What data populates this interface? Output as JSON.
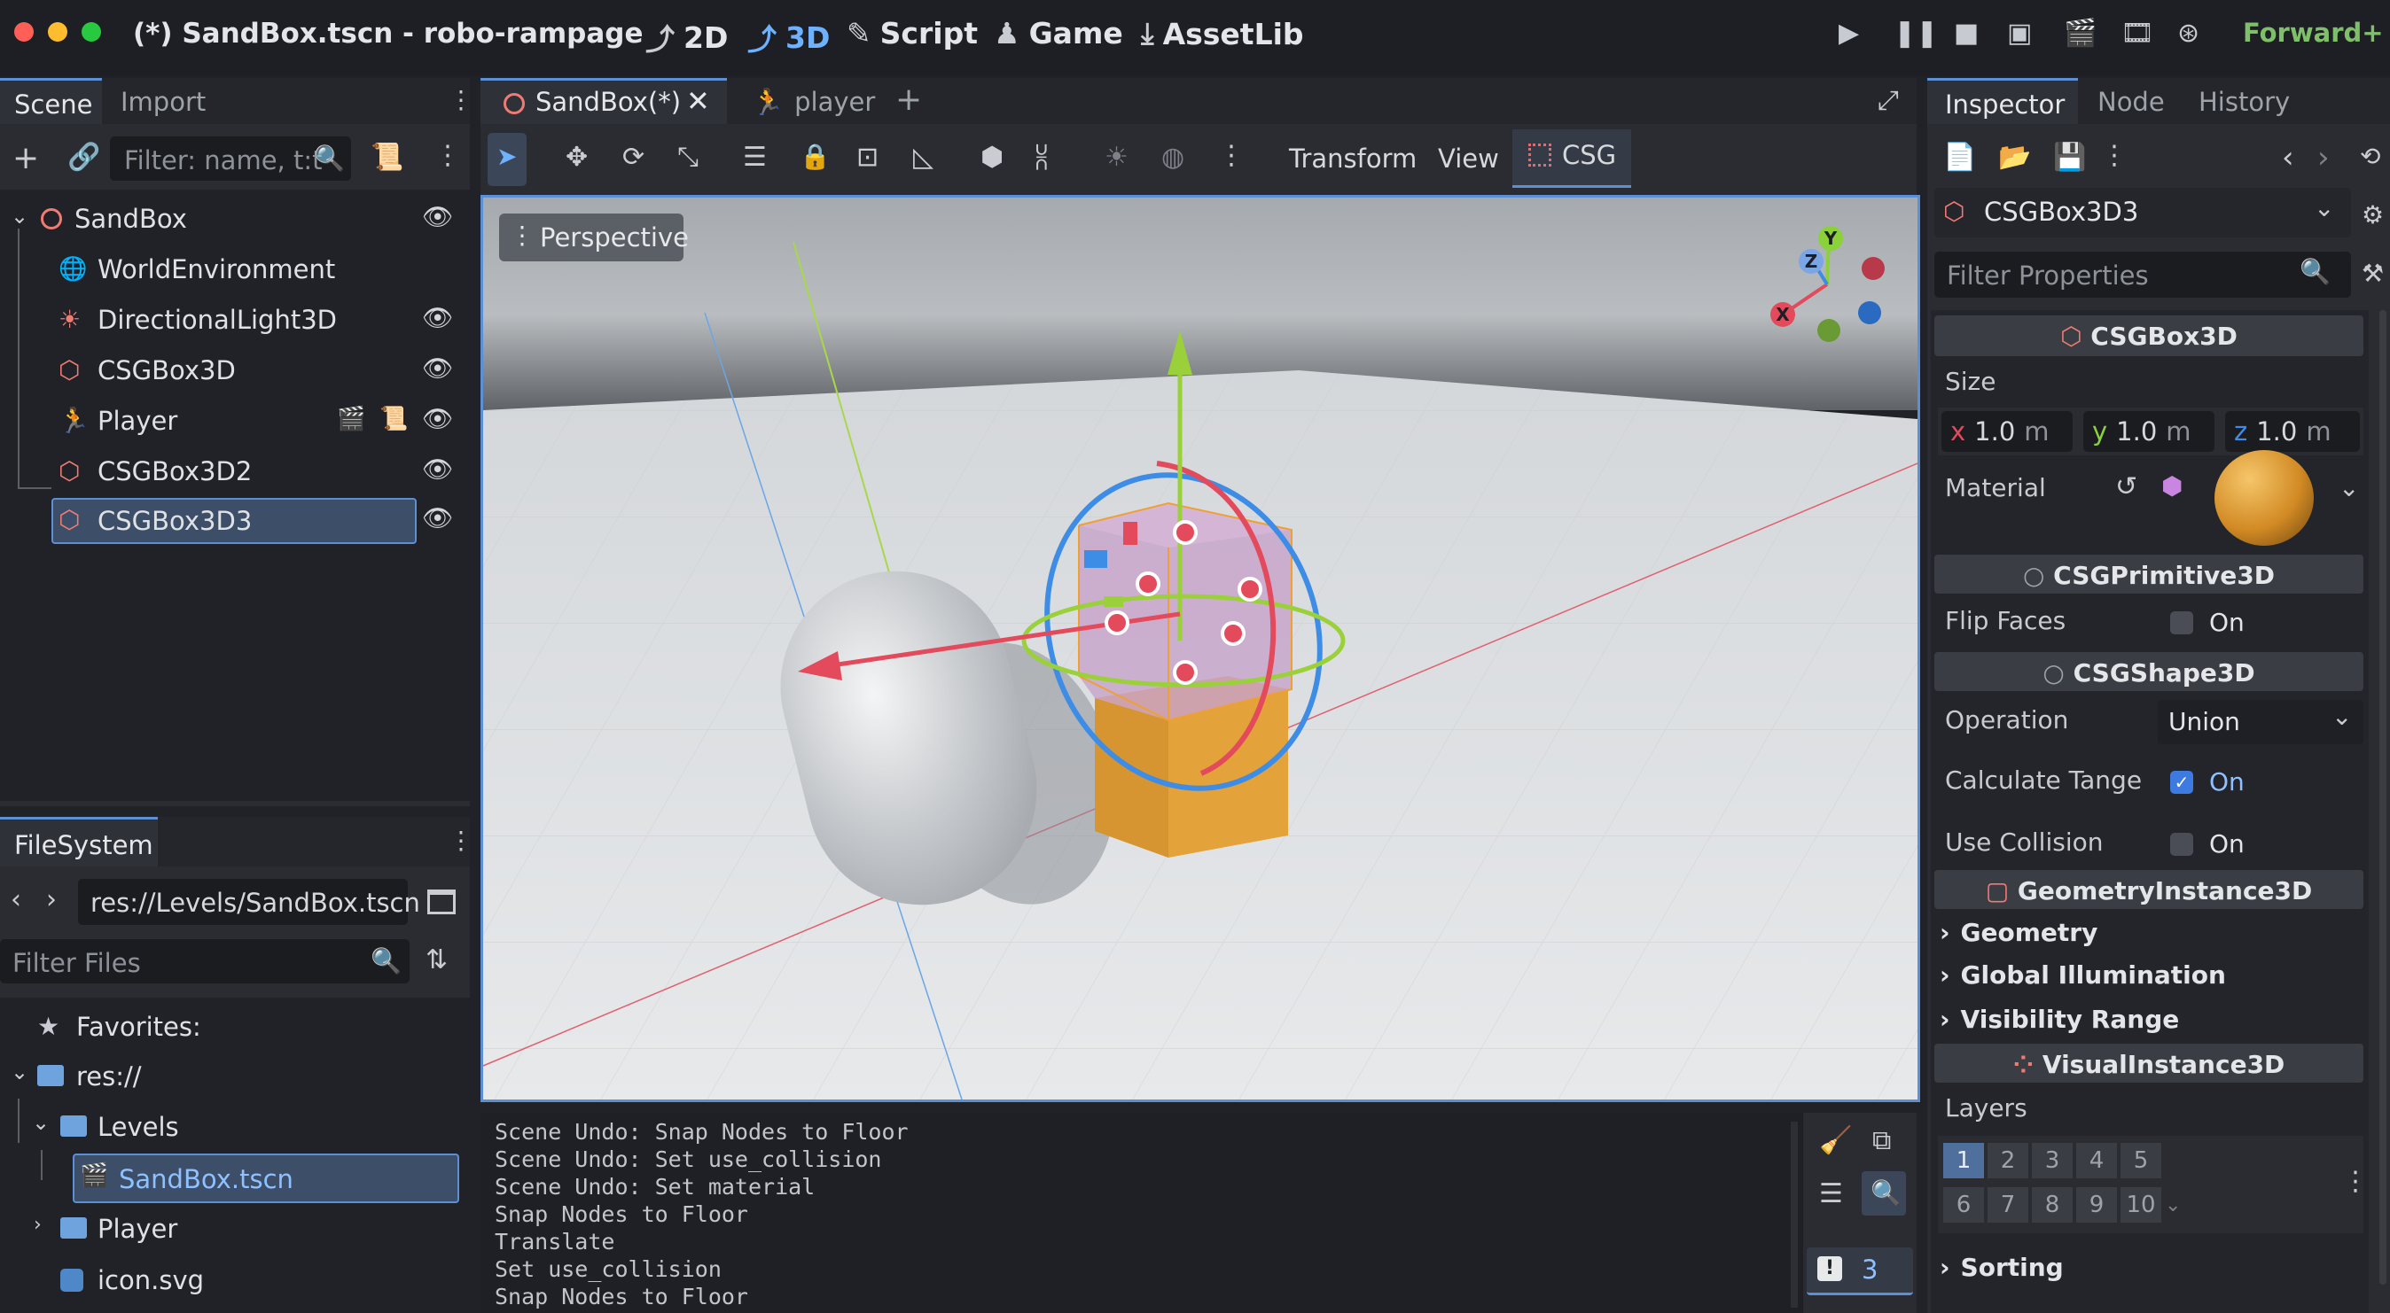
{
  "titlebar": {
    "title": "(*) SandBox.tscn - robo-rampage",
    "tabs": [
      "2D",
      "3D",
      "Script",
      "Game",
      "AssetLib"
    ],
    "active_tab": "3D",
    "renderer": "Forward+"
  },
  "scene_dock": {
    "tabs": [
      "Scene",
      "Import"
    ],
    "filter_placeholder": "Filter: name, t:t",
    "nodes": [
      {
        "label": "SandBox",
        "icon": "node3d-icon"
      },
      {
        "label": "WorldEnvironment",
        "icon": "world-environment-icon"
      },
      {
        "label": "DirectionalLight3D",
        "icon": "directional-light-icon"
      },
      {
        "label": "CSGBox3D",
        "icon": "csg-box-icon"
      },
      {
        "label": "Player",
        "icon": "player-icon"
      },
      {
        "label": "CSGBox3D2",
        "icon": "csg-box-icon"
      },
      {
        "label": "CSGBox3D3",
        "icon": "csg-box-icon"
      }
    ],
    "selected": "CSGBox3D3"
  },
  "filesystem": {
    "tab": "FileSystem",
    "path": "res://Levels/SandBox.tscn",
    "filter_placeholder": "Filter Files",
    "items": {
      "favorites": "Favorites:",
      "res": "res://",
      "levels": "Levels",
      "sandbox": "SandBox.tscn",
      "player": "Player",
      "icon": "icon.svg"
    }
  },
  "editor": {
    "tabs": [
      "SandBox(*)",
      "player"
    ],
    "toolbar_menus": [
      "Transform",
      "View",
      "CSG"
    ],
    "viewport_label": "Perspective",
    "gizmo_axes": [
      "Y",
      "Z",
      "X"
    ]
  },
  "output": {
    "lines": [
      "Scene Undo: Snap Nodes to Floor",
      "Scene Undo: Set use_collision",
      "Scene Undo: Set material",
      "Snap Nodes to Floor",
      "Translate",
      "Set use_collision",
      "Snap Nodes to Floor"
    ],
    "error_count": "3"
  },
  "inspector": {
    "tabs": [
      "Inspector",
      "Node",
      "History"
    ],
    "object": "CSGBox3D3",
    "filter_placeholder": "Filter Properties",
    "sections": {
      "csgbox": "CSGBox3D",
      "primitive": "CSGPrimitive3D",
      "shape": "CSGShape3D",
      "geometry_instance": "GeometryInstance3D",
      "visual_instance": "VisualInstance3D"
    },
    "size_label": "Size",
    "size": {
      "x": "1.0",
      "y": "1.0",
      "z": "1.0",
      "unit": "m",
      "x_label": "x",
      "y_label": "y",
      "z_label": "z"
    },
    "material_label": "Material",
    "flip_faces": {
      "label": "Flip Faces",
      "value": "On",
      "checked": false
    },
    "operation": {
      "label": "Operation",
      "value": "Union"
    },
    "calculate_tangents": {
      "label": "Calculate Tange",
      "value": "On",
      "checked": true
    },
    "use_collision": {
      "label": "Use Collision",
      "value": "On",
      "checked": false
    },
    "groups": [
      "Geometry",
      "Global Illumination",
      "Visibility Range"
    ],
    "layers_label": "Layers",
    "layers": [
      "1",
      "2",
      "3",
      "4",
      "5",
      "6",
      "7",
      "8",
      "9",
      "10"
    ],
    "sorting_label": "Sorting"
  },
  "colors": {
    "accent": "#5c8fd6",
    "csg_box": "#e5a33a",
    "x_axis": "#e34a5c",
    "y_axis": "#8ad13a",
    "z_axis": "#3d8ce6",
    "renderer": "#7fbf6a"
  }
}
